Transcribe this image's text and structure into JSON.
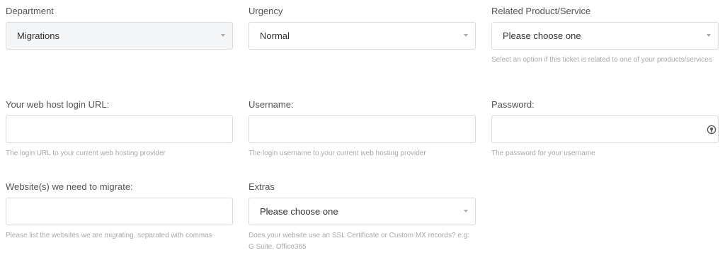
{
  "department": {
    "label": "Department",
    "value": "Migrations"
  },
  "urgency": {
    "label": "Urgency",
    "value": "Normal"
  },
  "related": {
    "label": "Related Product/Service",
    "value": "Please choose one",
    "help": "Select an option if this ticket is related to one of your products/services"
  },
  "login_url": {
    "label": "Your web host login URL:",
    "value": "",
    "help": "The login URL to your current web hosting provider"
  },
  "username": {
    "label": "Username:",
    "value": "",
    "help": "The login username to your current web hosting provider"
  },
  "password": {
    "label": "Password:",
    "value": "",
    "help": "The password for your username",
    "icon": "password-manager-icon"
  },
  "websites": {
    "label": "Website(s) we need to migrate:",
    "value": "",
    "help": "Please list the websites we are migrating, separated with commas"
  },
  "extras": {
    "label": "Extras",
    "value": "Please choose one",
    "help": "Does your website use an SSL Certificate or Custom MX records? e.g: G Suite, Office365"
  }
}
